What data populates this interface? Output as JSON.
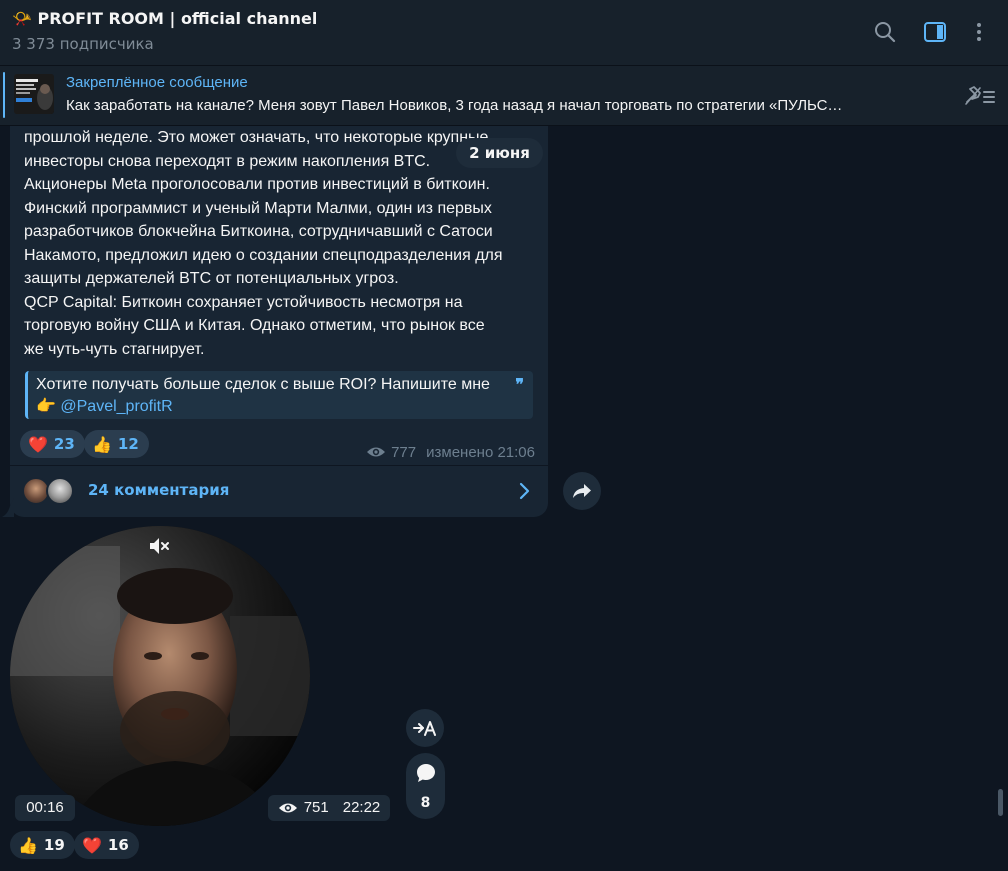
{
  "header": {
    "title": "📯 PROFIT ROOM | official channel",
    "subtitle": "3 373 подписчика",
    "icons": [
      "search-icon",
      "sidebar-panel-icon",
      "more-vertical-icon"
    ]
  },
  "pinned": {
    "title": "Закреплённое сообщение",
    "text": "Как заработать на канале?   Меня зовут Павел Новиков, 3 года назад я начал торговать по стратегии «ПУЛЬС…"
  },
  "post": {
    "lines": [
      "прошлой неделе. Это может означать, что некоторые крупные",
      "инвесторы снова переходят в режим накопления BTC.",
      "Акционеры Meta проголосовали против инвестиций в биткоин.",
      "Финский программист и ученый Марти Малми, один из первых",
      "разработчиков блокчейна Биткоина, сотрудничавший с Сатоси",
      "Накамото, предложил идею о создании спецподразделения для",
      "защиты держателей BTC от потенциальных угроз.",
      "QCP Capital: Биткоин сохраняет устойчивость несмотря на",
      "торговую войну США и Китая. Однако отметим, что рынок все",
      "же чуть-чуть стагнирует."
    ],
    "quote_text": "Хотите получать больше сделок с выше ROI? Напишите мне",
    "quote_pointer": "👉",
    "quote_mention": "@Pavel_profitR",
    "quote_mark": "❞",
    "reactions": [
      {
        "emoji": "❤️",
        "count": "23"
      },
      {
        "emoji": "👍",
        "count": "12"
      }
    ],
    "views": "777",
    "edited": "изменено 21:06",
    "comments": "24 комментария"
  },
  "date_separator": "2 июня",
  "video": {
    "duration": "00:16",
    "views": "751",
    "time": "22:22",
    "comments_count": "8",
    "reactions": [
      {
        "emoji": "👍",
        "count": "19"
      },
      {
        "emoji": "❤️",
        "count": "16"
      }
    ]
  },
  "colors": {
    "background": "#0e1621",
    "header": "#17212b",
    "bubble": "#182533",
    "accent": "#5eb5f7",
    "muted": "#6d7f8f"
  }
}
